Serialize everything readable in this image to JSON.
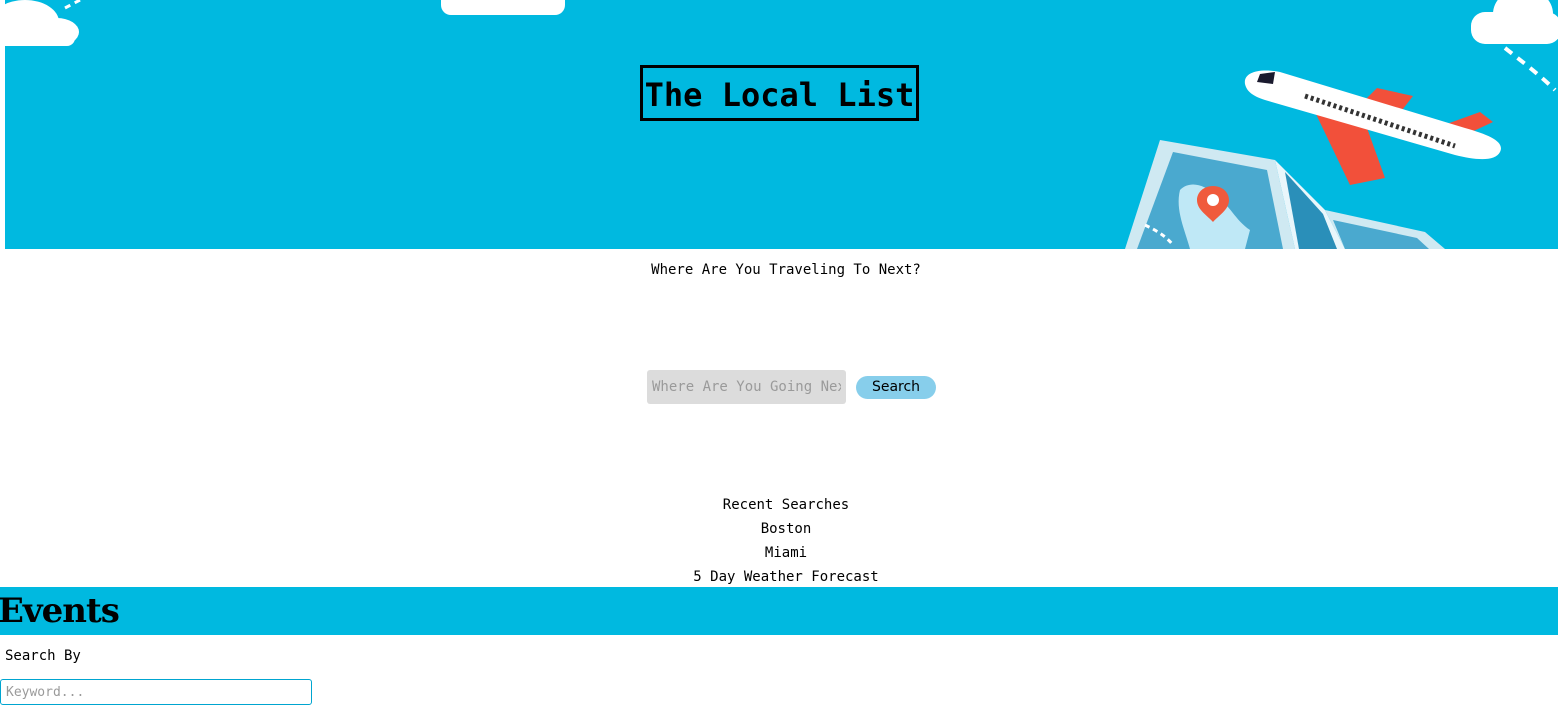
{
  "header": {
    "title": "The Local List",
    "background_color": "#00b9e0"
  },
  "main": {
    "tagline": "Where Are You Traveling To Next?",
    "search": {
      "placeholder": "Where Are You Going Next?",
      "value": "",
      "button_label": "Search",
      "button_color": "#87ceeb"
    },
    "recent": {
      "heading": "Recent Searches",
      "items": [
        "Boston",
        "Miami"
      ],
      "forecast_label": "5 Day Weather Forecast"
    }
  },
  "events": {
    "title": "Events",
    "search_by_label": "Search By",
    "keyword_placeholder": "Keyword..."
  },
  "icons": [
    "cloud-icon",
    "airplane-icon",
    "map-icon",
    "location-pin-icon"
  ]
}
